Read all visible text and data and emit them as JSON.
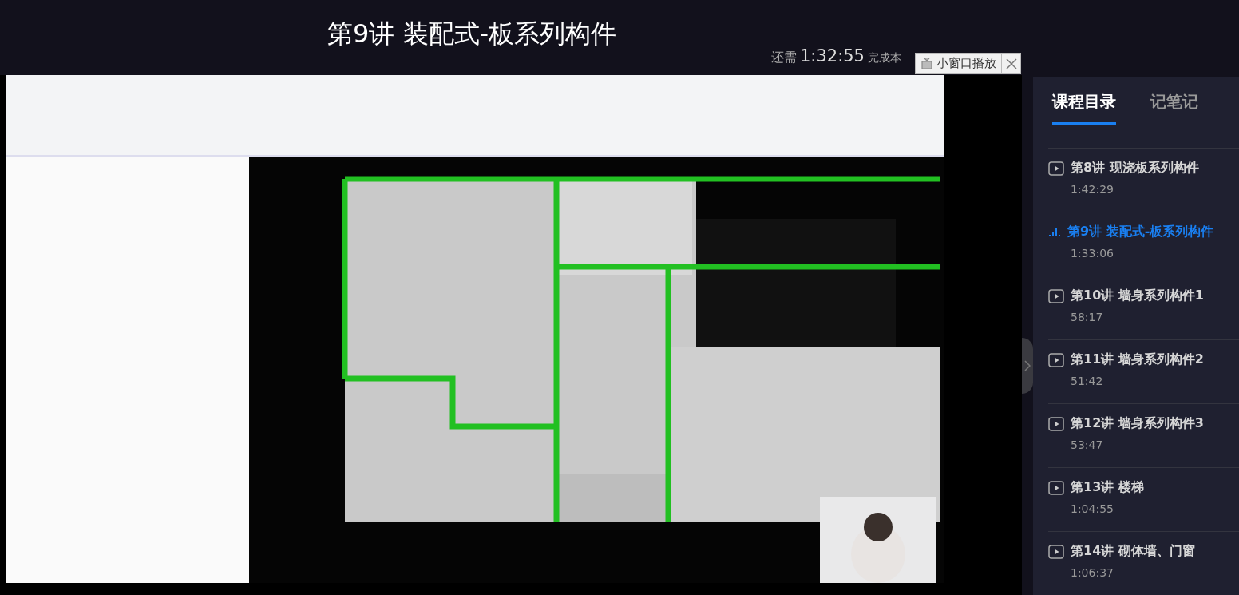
{
  "header": {
    "title": "第9讲 装配式-板系列构件",
    "remaining_label": "还需",
    "remaining_time": "1:32:55",
    "remaining_suffix": "完成本"
  },
  "mini_player": {
    "label": "小窗口播放"
  },
  "sidebar": {
    "tabs": [
      {
        "label": "课程目录",
        "selected": true
      },
      {
        "label": "记笔记",
        "selected": false
      }
    ],
    "lessons": [
      {
        "title": "第8讲 现浇板系列构件",
        "duration": "1:42:29",
        "selected": false
      },
      {
        "title": "第9讲 装配式-板系列构件",
        "duration": "1:33:06",
        "selected": true
      },
      {
        "title": "第10讲 墙身系列构件1",
        "duration": "58:17",
        "selected": false
      },
      {
        "title": "第11讲 墙身系列构件2",
        "duration": "51:42",
        "selected": false
      },
      {
        "title": "第12讲 墙身系列构件3",
        "duration": "53:47",
        "selected": false
      },
      {
        "title": "第13讲 楼梯",
        "duration": "1:04:55",
        "selected": false
      },
      {
        "title": "第14讲 砌体墙、门窗",
        "duration": "1:06:37",
        "selected": false
      }
    ]
  }
}
